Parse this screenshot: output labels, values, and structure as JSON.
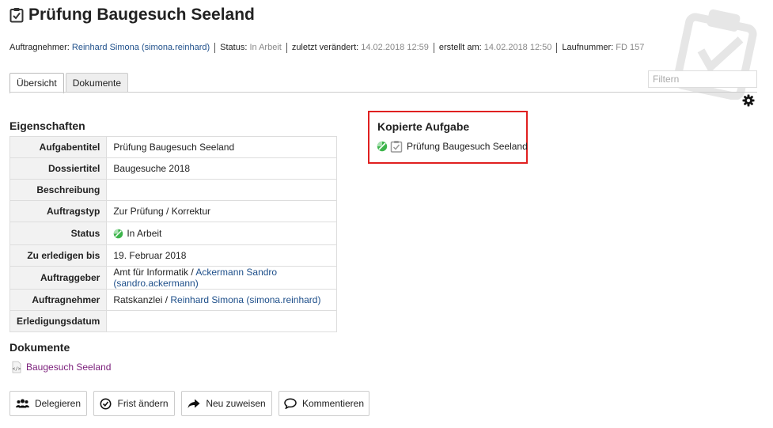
{
  "header": {
    "title": "Prüfung Baugesuch Seeland",
    "title_icon": "task-checkbox-icon"
  },
  "meta": {
    "assignee_label": "Auftragnehmer:",
    "assignee_value": "Reinhard Simona (simona.reinhard)",
    "status_label": "Status:",
    "status_value": "In Arbeit",
    "modified_label": "zuletzt verändert:",
    "modified_value": "14.02.2018 12:59",
    "created_label": "erstellt am:",
    "created_value": "14.02.2018 12:50",
    "sequence_label": "Laufnummer:",
    "sequence_value": "FD 157"
  },
  "tabs": [
    {
      "label": "Übersicht",
      "active": true
    },
    {
      "label": "Dokumente",
      "active": false
    }
  ],
  "filter": {
    "placeholder": "Filtern",
    "value": ""
  },
  "properties": {
    "title": "Eigenschaften",
    "rows": [
      {
        "key": "Aufgabentitel",
        "value": "Prüfung Baugesuch Seeland"
      },
      {
        "key": "Dossiertitel",
        "value": "Baugesuche 2018"
      },
      {
        "key": "Beschreibung",
        "value": ""
      },
      {
        "key": "Auftragstyp",
        "value": "Zur Prüfung / Korrektur"
      },
      {
        "key": "Status",
        "value": "In Arbeit"
      },
      {
        "key": "Zu erledigen bis",
        "value": "19. Februar 2018"
      },
      {
        "key": "Auftraggeber",
        "value_prefix": "Amt für Informatik / ",
        "value_link": "Ackermann Sandro (sandro.ackermann)"
      },
      {
        "key": "Auftragnehmer",
        "value_prefix": "Ratskanzlei / ",
        "value_link": "Reinhard Simona (simona.reinhard)"
      },
      {
        "key": "Erledigungsdatum",
        "value": ""
      }
    ]
  },
  "copied_task": {
    "title": "Kopierte Aufgabe",
    "item_label": "Prüfung Baugesuch Seeland"
  },
  "documents": {
    "title": "Dokumente",
    "items": [
      {
        "label": "Baugesuch Seeland",
        "icon": "code-file-icon"
      }
    ]
  },
  "actions": {
    "delegate": "Delegieren",
    "change_deadline": "Frist ändern",
    "reassign": "Neu zuweisen",
    "comment": "Kommentieren"
  },
  "colors": {
    "link": "#1e4f8a",
    "visited_link": "#7b1f7b",
    "status_green": "#3cb44b",
    "highlight_border": "#e02020"
  }
}
